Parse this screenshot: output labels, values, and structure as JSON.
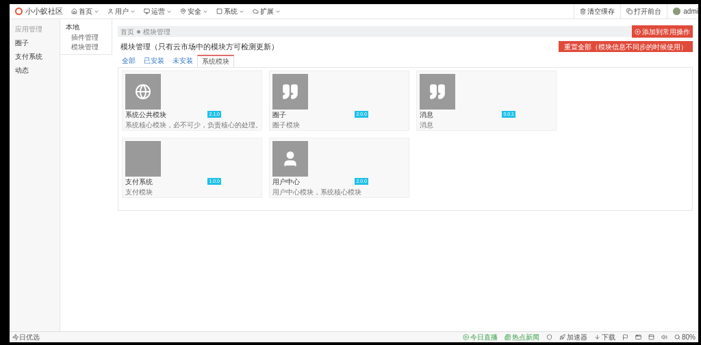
{
  "brand": {
    "name": "小小蚁社区"
  },
  "nav": [
    {
      "label": "首页"
    },
    {
      "label": "用户"
    },
    {
      "label": "运营"
    },
    {
      "label": "安全"
    },
    {
      "label": "系统"
    },
    {
      "label": "扩展"
    }
  ],
  "top_actions": [
    {
      "label": "清空缓存"
    },
    {
      "label": "打开前台"
    }
  ],
  "user": {
    "name": "admi"
  },
  "sidebar": {
    "items": [
      {
        "label": "应用管理",
        "kind": "header"
      },
      {
        "label": "圈子",
        "kind": "item"
      },
      {
        "label": "支付系统",
        "kind": "item"
      },
      {
        "label": "动态",
        "kind": "item"
      }
    ]
  },
  "subnav": {
    "items": [
      {
        "label": "本地",
        "children": [
          {
            "label": "插件管理"
          },
          {
            "label": "模块管理"
          }
        ]
      }
    ]
  },
  "breadcrumb": [
    "首页",
    "模块管理"
  ],
  "add_button": "添加到常用操作",
  "title": "模块管理（只有云市场中的模块方可检测更新）",
  "reset_button": "重置全部（模块信息不同步的时候使用）",
  "tabs": [
    {
      "label": "全部",
      "selected": false
    },
    {
      "label": "已安装",
      "selected": false
    },
    {
      "label": "未安装",
      "selected": false
    },
    {
      "label": "系统模块",
      "selected": true
    }
  ],
  "modules": [
    {
      "name": "系统公共模块",
      "version": "2.1.0",
      "description": "系统核心模块，必不可少，负责核心的处理。",
      "kind": "globe"
    },
    {
      "name": "圈子",
      "version": "2.0.0",
      "description": "圈子模块",
      "kind": "quote"
    },
    {
      "name": "消息",
      "version": "0.0.1",
      "description": "消息",
      "kind": "quote"
    },
    {
      "name": "支付系统",
      "version": "1.0.0",
      "description": "支付模块",
      "kind": "blank"
    },
    {
      "name": "用户中心",
      "version": "2.0.0",
      "description": "用户中心模块，系统核心模块",
      "kind": "person"
    }
  ],
  "status_bar": {
    "left": "今日优选",
    "items": [
      {
        "label": "今日直播"
      },
      {
        "label": "热点新闻"
      },
      {
        "label": "加速器"
      },
      {
        "label": "下载"
      },
      {
        "label": "80%"
      }
    ]
  }
}
